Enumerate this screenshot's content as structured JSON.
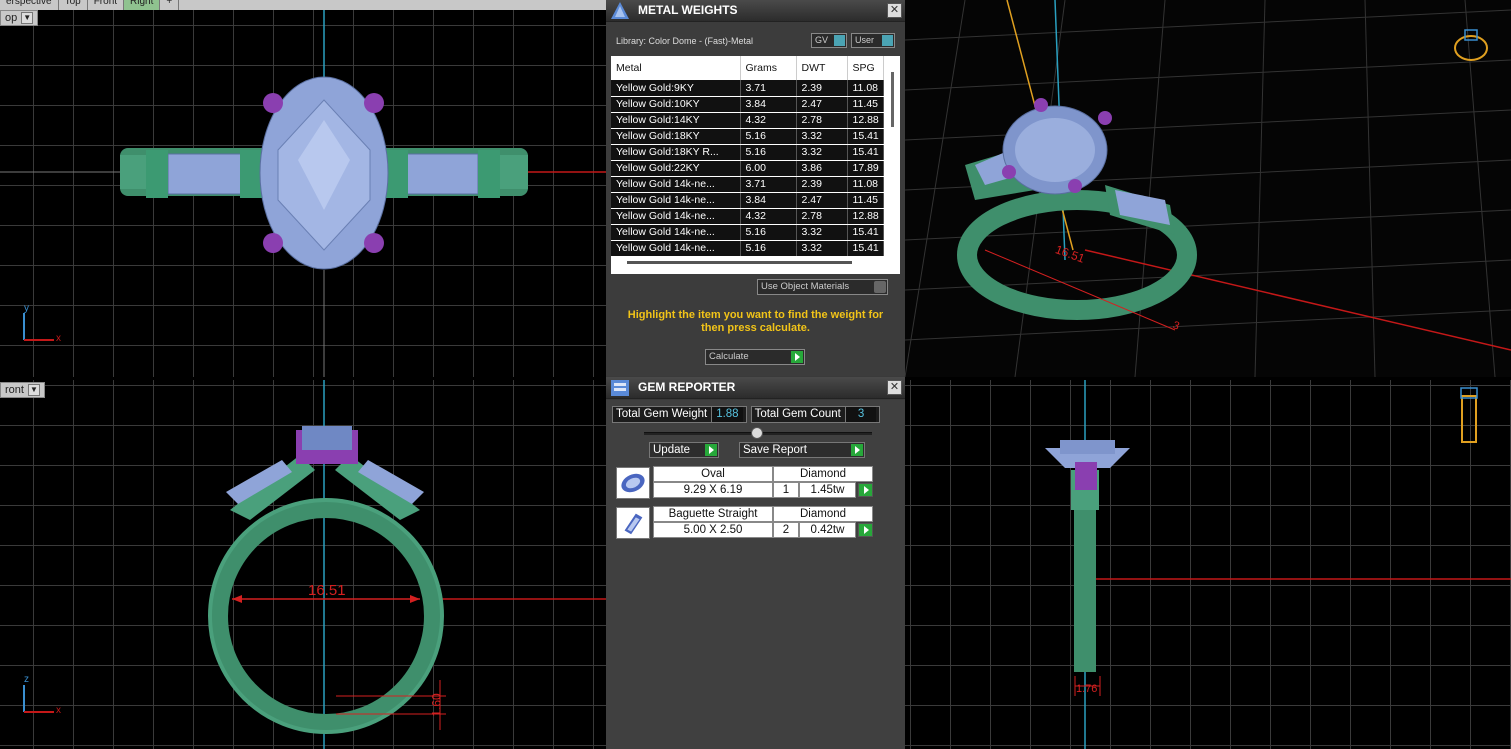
{
  "viewport_tabs": [
    "erspective",
    "Top",
    "Front",
    "Right",
    "+"
  ],
  "viewport_tabs_active": 3,
  "viewports": {
    "top_left": {
      "label": "op",
      "axes": [
        "y",
        "x"
      ]
    },
    "bottom_left": {
      "label": "ront",
      "axes": [
        "z",
        "x"
      ],
      "dimension": "16.51",
      "dimension2": "1.60"
    },
    "top_right": {
      "dimension": "16.51",
      "dimension2": "3"
    },
    "bottom_right": {
      "dimension": "1.76"
    }
  },
  "metal_weights": {
    "title": "METAL WEIGHTS",
    "library": "Library: Color Dome - (Fast)-Metal",
    "gv_label": "GV",
    "user_label": "User",
    "columns": [
      "Metal",
      "Grams",
      "DWT",
      "SPG"
    ],
    "rows": [
      [
        "Yellow Gold:9KY",
        "3.71",
        "2.39",
        "11.08"
      ],
      [
        "Yellow Gold:10KY",
        "3.84",
        "2.47",
        "11.45"
      ],
      [
        "Yellow Gold:14KY",
        "4.32",
        "2.78",
        "12.88"
      ],
      [
        "Yellow Gold:18KY",
        "5.16",
        "3.32",
        "15.41"
      ],
      [
        "Yellow Gold:18KY R...",
        "5.16",
        "3.32",
        "15.41"
      ],
      [
        "Yellow Gold:22KY",
        "6.00",
        "3.86",
        "17.89"
      ],
      [
        "Yellow Gold 14k-ne...",
        "3.71",
        "2.39",
        "11.08"
      ],
      [
        "Yellow Gold 14k-ne...",
        "3.84",
        "2.47",
        "11.45"
      ],
      [
        "Yellow Gold 14k-ne...",
        "4.32",
        "2.78",
        "12.88"
      ],
      [
        "Yellow Gold 14k-ne...",
        "5.16",
        "3.32",
        "15.41"
      ],
      [
        "Yellow Gold 14k-ne...",
        "5.16",
        "3.32",
        "15.41"
      ]
    ],
    "materials_dropdown": "Use Object Materials",
    "hint": "Highlight the item you want to find the weight for then press calculate.",
    "calculate_label": "Calculate"
  },
  "gem_reporter": {
    "title": "GEM REPORTER",
    "total_weight_label": "Total Gem Weight",
    "total_weight": "1.88",
    "total_count_label": "Total Gem Count",
    "total_count": "3",
    "update_label": "Update",
    "save_label": "Save Report",
    "gems": [
      {
        "shape": "Oval",
        "type": "Diamond",
        "dims": "9.29 X 6.19",
        "count": "1",
        "weight": "1.45tw"
      },
      {
        "shape": "Baguette Straight",
        "type": "Diamond",
        "dims": "5.00 X 2.50",
        "count": "2",
        "weight": "0.42tw"
      }
    ]
  },
  "colors": {
    "band": "#3f8f6c",
    "stone": "#8fa4d8",
    "prong": "#8a3fb0",
    "dimension": "#d42020",
    "axis": "#2aa0c0",
    "hint_text": "#f2c418"
  }
}
